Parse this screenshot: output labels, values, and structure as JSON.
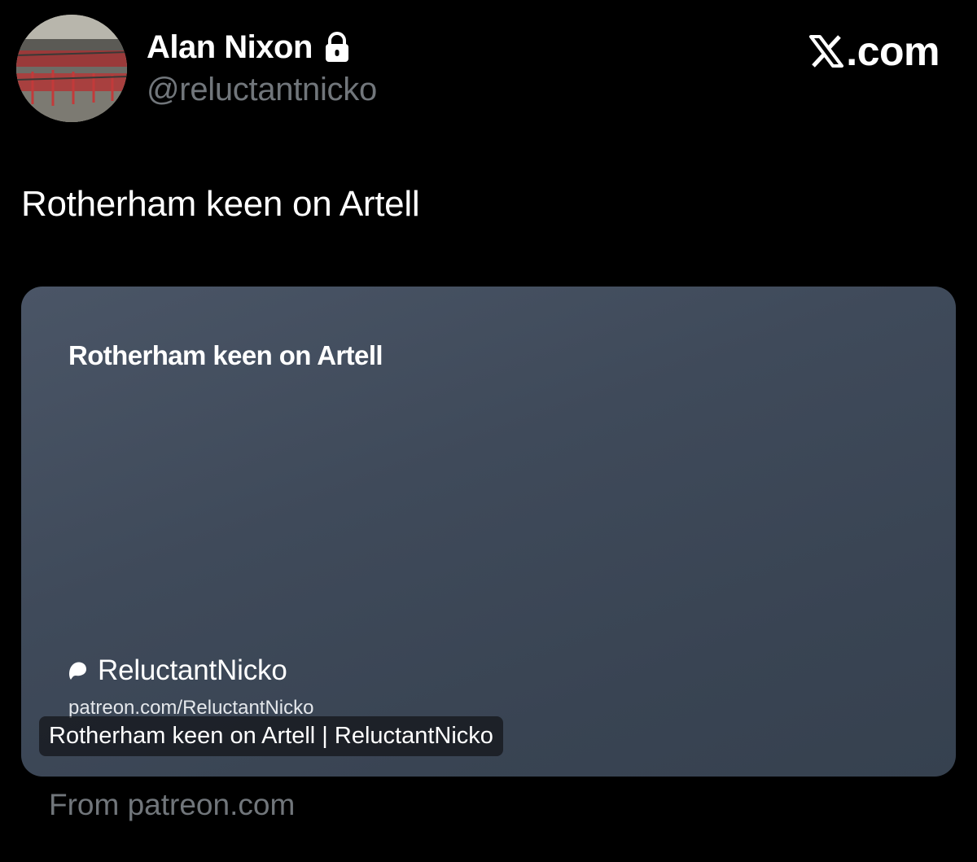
{
  "author": {
    "name": "Alan Nixon",
    "handle": "@reluctantnicko",
    "avatar_icon": "stadium-photo-avatar",
    "protected_icon": "lock-icon"
  },
  "brand": {
    "logo_icon": "x-logo-icon",
    "text": ".com"
  },
  "tweet": {
    "text": "Rotherham keen on Artell"
  },
  "link_card": {
    "headline": "Rotherham keen on Artell",
    "creator_icon": "patreon-icon",
    "creator_name": "ReluctantNicko",
    "url": "patreon.com/ReluctantNicko",
    "title": "Rotherham keen on Artell | ReluctantNicko",
    "source": "From patreon.com"
  },
  "colors": {
    "background": "#000000",
    "primary_text": "#ffffff",
    "secondary_text": "#71767b",
    "card_background": "#3f4a5a"
  }
}
